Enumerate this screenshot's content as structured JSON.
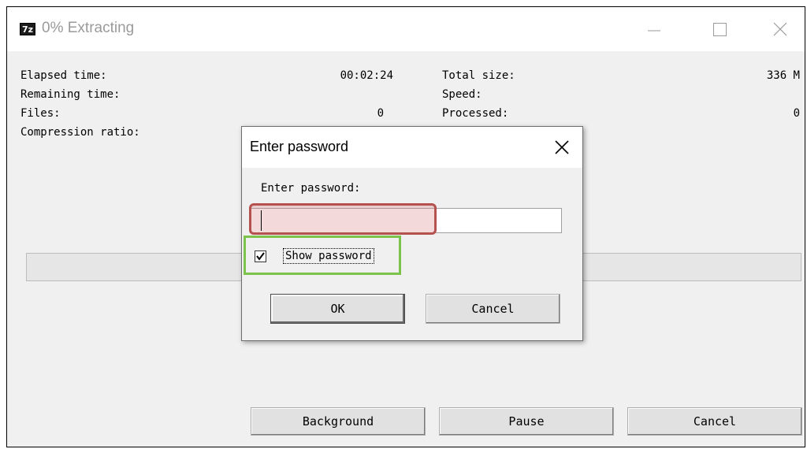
{
  "window": {
    "icon_text": "7z",
    "title": "0% Extracting"
  },
  "stats": {
    "elapsed_label": "Elapsed time:",
    "elapsed_value": "00:02:24",
    "remaining_label": "Remaining time:",
    "files_label": "Files:",
    "files_value": "0",
    "ratio_label": "Compression ratio:",
    "total_size_label": "Total size:",
    "total_size_value": "336 M",
    "speed_label": "Speed:",
    "processed_label": "Processed:",
    "processed_value": "0"
  },
  "progress": 0,
  "buttons": {
    "background": "Background",
    "pause": "Pause",
    "cancel": "Cancel"
  },
  "dialog": {
    "title": "Enter password",
    "field_label": "Enter password:",
    "password_value": "",
    "show_password_label": "Show password",
    "show_password_checked": true,
    "ok_label": "OK",
    "cancel_label": "Cancel"
  },
  "colors": {
    "highlight_red": "#b5514f",
    "highlight_green": "#7bc34a"
  }
}
